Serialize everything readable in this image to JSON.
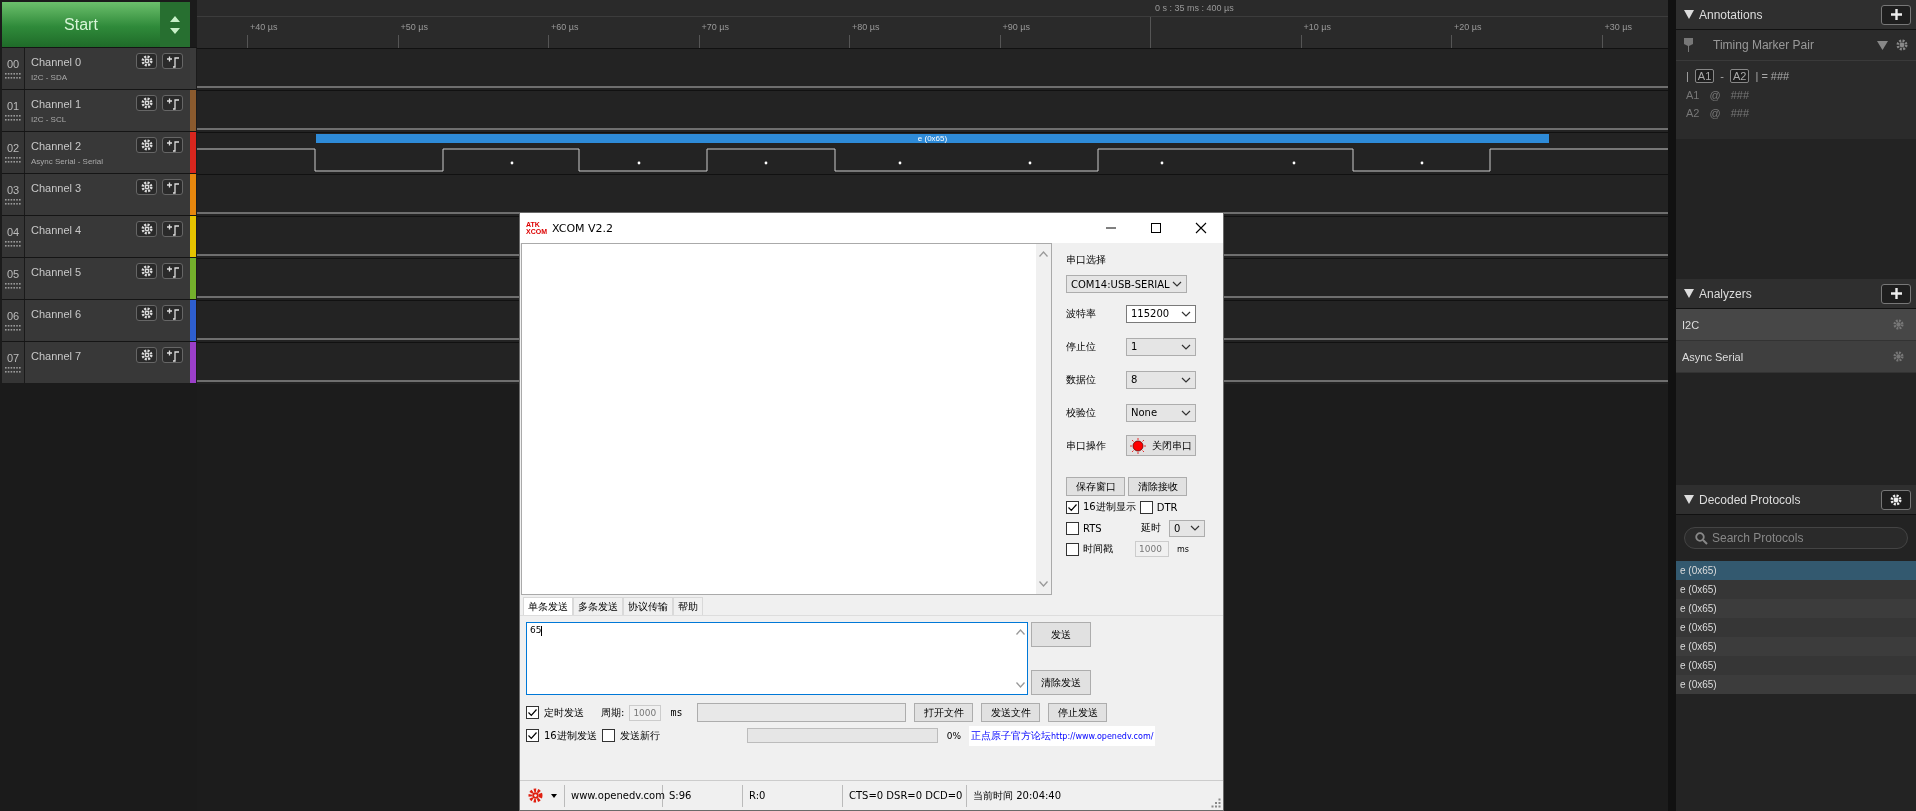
{
  "start_button": {
    "label": "Start"
  },
  "channels": [
    {
      "number": "00",
      "name": "Channel 0",
      "analyzer": "I2C - SDA",
      "color": "#3a3a3a",
      "kind": "idle"
    },
    {
      "number": "01",
      "name": "Channel 1",
      "analyzer": "I2C - SCL",
      "color": "#8a5a2e",
      "kind": "idle"
    },
    {
      "number": "02",
      "name": "Channel 2",
      "analyzer": "Async Serial - Serial",
      "color": "#d8261e",
      "kind": "serial",
      "decoded": "e (0x65)"
    },
    {
      "number": "03",
      "name": "Channel 3",
      "color": "#e6870e",
      "kind": "idle"
    },
    {
      "number": "04",
      "name": "Channel 4",
      "color": "#e5c300",
      "kind": "idle"
    },
    {
      "number": "05",
      "name": "Channel 5",
      "color": "#74b02c",
      "kind": "idle"
    },
    {
      "number": "06",
      "name": "Channel 6",
      "color": "#2e5fcf",
      "kind": "idle"
    },
    {
      "number": "07",
      "name": "Channel 7",
      "color": "#9b3fc9",
      "kind": "idle"
    }
  ],
  "ruler": {
    "origin": "0 s : 35 ms : 400 µs",
    "ticks": [
      "+40 µs",
      "+50 µs",
      "+60 µs",
      "+70 µs",
      "+80 µs",
      "+90 µs",
      "+10 µs",
      "+20 µs",
      "+30 µs"
    ]
  },
  "annotations": {
    "title": "Annotations",
    "marker": "Timing Marker Pair",
    "formula": {
      "left": "|",
      "a1": "A1",
      "dash": "-",
      "a2": "A2",
      "right": "| = ###"
    },
    "rows": [
      {
        "label": "A1",
        "at": "@",
        "value": "###"
      },
      {
        "label": "A2",
        "at": "@",
        "value": "###"
      }
    ]
  },
  "analyzers": {
    "title": "Analyzers",
    "items": [
      {
        "label": "I2C"
      },
      {
        "label": "Async Serial"
      }
    ]
  },
  "decoded_protocols": {
    "title": "Decoded Protocols",
    "search": {
      "placeholder": "Search Protocols"
    },
    "items": [
      {
        "label": "e (0x65)",
        "selected": true
      },
      {
        "label": "e (0x65)",
        "selected": false
      },
      {
        "label": "e (0x65)",
        "selected": false
      },
      {
        "label": "e (0x65)",
        "selected": false
      },
      {
        "label": "e (0x65)",
        "selected": false
      },
      {
        "label": "e (0x65)",
        "selected": false
      },
      {
        "label": "e (0x65)",
        "selected": false
      }
    ]
  },
  "xcom": {
    "logo": [
      "ATK",
      "XCOM"
    ],
    "title": "XCOM V2.2",
    "settings": [
      {
        "label": "串口选择",
        "kind": "wide",
        "value": "COM14:USB-SERIAL"
      },
      {
        "label": "波特率",
        "kind": "select",
        "value": "115200",
        "focused": true
      },
      {
        "label": "停止位",
        "kind": "select",
        "value": "1",
        "focused": false
      },
      {
        "label": "数据位",
        "kind": "select",
        "value": "8",
        "focused": false
      },
      {
        "label": "校验位",
        "kind": "select",
        "value": "None",
        "focused": false
      },
      {
        "label": "串口操作",
        "kind": "button",
        "value": "关闭串口"
      }
    ],
    "save_button": "保存窗口",
    "clear_receive_button": "清除接收",
    "hex_display": {
      "label": "16进制显示",
      "checked": true
    },
    "dtr": {
      "label": "DTR",
      "checked": false
    },
    "rts": {
      "label": "RTS",
      "checked": false
    },
    "delay": {
      "label": "延时",
      "value": "0"
    },
    "timestamp": {
      "label": "时间戳",
      "checked": false,
      "value": "1000",
      "unit": "ms"
    },
    "tabs": [
      {
        "label": "单条发送",
        "selected": true
      },
      {
        "label": "多条发送",
        "selected": false
      },
      {
        "label": "协议传输",
        "selected": false
      },
      {
        "label": "帮助",
        "selected": false
      }
    ],
    "send_text": "65",
    "send_button": "发送",
    "clear_send_button": "清除发送",
    "timed_send": {
      "label": "定时发送",
      "checked": true
    },
    "period": {
      "label": "周期:",
      "value": "1000",
      "unit": "ms"
    },
    "file_buttons": [
      "打开文件",
      "发送文件",
      "停止发送"
    ],
    "hex_send": {
      "label": "16进制发送",
      "checked": true
    },
    "send_newline": {
      "label": "发送新行",
      "checked": false
    },
    "progress": {
      "level": 0,
      "reading": "0%"
    },
    "forum": {
      "name": "正点原子官方论坛",
      "url": "http://www.openedv.com/"
    },
    "status": [
      "www.openedv.com",
      "S:96",
      "R:0",
      "CTS=0 DSR=0 DCD=0",
      "当前时间 20:04:40"
    ]
  }
}
